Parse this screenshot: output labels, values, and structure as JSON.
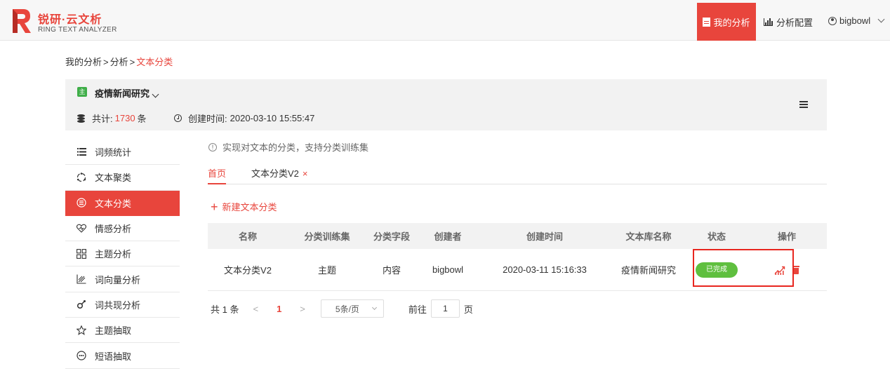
{
  "header": {
    "brand_title": "锐研·云文析",
    "brand_subtitle": "RING TEXT ANALYZER",
    "nav_my_analysis": "我的分析",
    "nav_config": "分析配置",
    "user_name": "bigbowl",
    "accent": "#e8453c"
  },
  "breadcrumb": {
    "items": [
      "我的分析",
      "分析",
      "文本分类"
    ],
    "separator": ">"
  },
  "project": {
    "badge": "主",
    "name": "疫情新闻研究",
    "count_label": "共计:",
    "count_value": "1730",
    "count_unit": "条",
    "created_label": "创建时间:",
    "created_value": "2020-03-10 15:55:47"
  },
  "sidebar": {
    "items": [
      {
        "label": "词频统计",
        "icon": "list-icon"
      },
      {
        "label": "文本聚类",
        "icon": "cluster-icon"
      },
      {
        "label": "文本分类",
        "icon": "classify-icon",
        "active": true
      },
      {
        "label": "情感分析",
        "icon": "heart-icon"
      },
      {
        "label": "主题分析",
        "icon": "grid-icon"
      },
      {
        "label": "词向量分析",
        "icon": "vector-icon"
      },
      {
        "label": "词共现分析",
        "icon": "link-icon"
      },
      {
        "label": "主题抽取",
        "icon": "star-icon"
      },
      {
        "label": "短语抽取",
        "icon": "chat-icon"
      }
    ]
  },
  "main": {
    "tip": "实现对文本的分类，支持分类训练集",
    "tabs": {
      "home": "首页",
      "v2": "文本分类V2",
      "close": "×"
    },
    "new_button": "新建文本分类",
    "table": {
      "headers": [
        "名称",
        "分类训练集",
        "分类字段",
        "创建者",
        "创建时间",
        "文本库名称",
        "状态",
        "操作"
      ],
      "rows": [
        {
          "name": "文本分类V2",
          "training_set": "主题",
          "field": "内容",
          "creator": "bigbowl",
          "created": "2020-03-11 15:16:33",
          "library": "疫情新闻研究",
          "status": "已完成"
        }
      ]
    },
    "pager": {
      "total": "共 1 条",
      "prev": "<",
      "current": "1",
      "next": ">",
      "page_size": "5条/页",
      "goto_label": "前往",
      "goto_value": "1",
      "page_unit": "页"
    }
  }
}
